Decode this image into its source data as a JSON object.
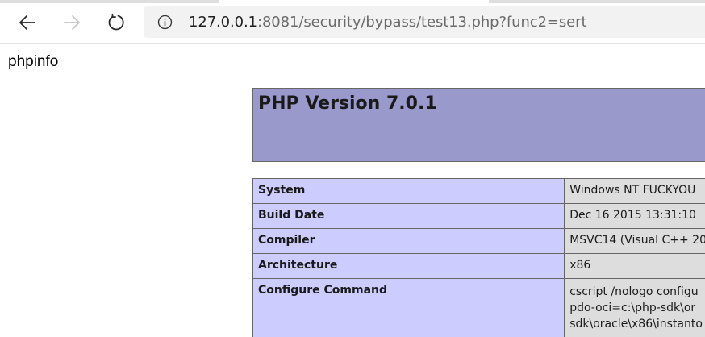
{
  "browser": {
    "url_host": "127.0.0.1",
    "url_rest": ":8081/security/bypass/test13.php?func2=sert"
  },
  "icons": {
    "back": "arrow-left-icon",
    "forward": "arrow-right-icon",
    "reload": "reload-icon",
    "info": "info-circle-icon"
  },
  "page": {
    "heading_text": "phpinfo",
    "php_version_title": "PHP Version 7.0.1",
    "rows": [
      {
        "label": "System",
        "value": "Windows NT FUCKYOU"
      },
      {
        "label": "Build Date",
        "value": "Dec 16 2015 13:31:10"
      },
      {
        "label": "Compiler",
        "value": "MSVC14 (Visual C++ 20"
      },
      {
        "label": "Architecture",
        "value": "x86"
      },
      {
        "label": "Configure Command",
        "value_lines": [
          "cscript /nologo configu",
          "pdo-oci=c:\\php-sdk\\or",
          "sdk\\oracle\\x86\\instanto"
        ]
      }
    ]
  },
  "colors": {
    "header_bg": "#9999cc",
    "label_bg": "#ccccff",
    "value_bg": "#dddddd"
  }
}
